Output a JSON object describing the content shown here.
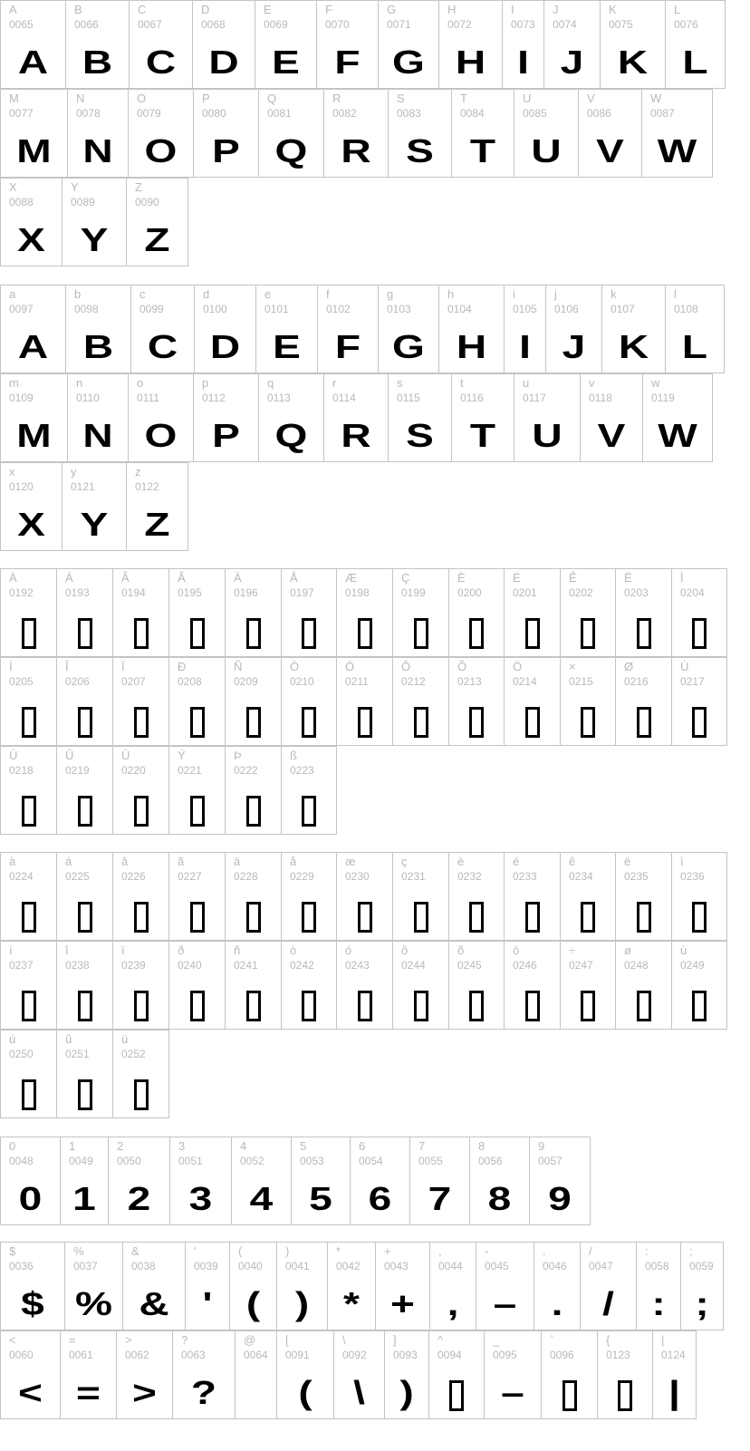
{
  "sections": [
    {
      "rows": [
        [
          {
            "label": "A",
            "code": "0065",
            "glyph": "A"
          },
          {
            "label": "B",
            "code": "0066",
            "glyph": "B"
          },
          {
            "label": "C",
            "code": "0067",
            "glyph": "C"
          },
          {
            "label": "D",
            "code": "0068",
            "glyph": "D"
          },
          {
            "label": "E",
            "code": "0069",
            "glyph": "E"
          },
          {
            "label": "F",
            "code": "0070",
            "glyph": "F"
          },
          {
            "label": "G",
            "code": "0071",
            "glyph": "G"
          },
          {
            "label": "H",
            "code": "0072",
            "glyph": "H"
          },
          {
            "label": "I",
            "code": "0073",
            "glyph": "I"
          },
          {
            "label": "J",
            "code": "0074",
            "glyph": "J"
          },
          {
            "label": "K",
            "code": "0075",
            "glyph": "K"
          },
          {
            "label": "L",
            "code": "0076",
            "glyph": "L"
          }
        ],
        [
          {
            "label": "M",
            "code": "0077",
            "glyph": "M"
          },
          {
            "label": "N",
            "code": "0078",
            "glyph": "N"
          },
          {
            "label": "O",
            "code": "0079",
            "glyph": "O"
          },
          {
            "label": "P",
            "code": "0080",
            "glyph": "P"
          },
          {
            "label": "Q",
            "code": "0081",
            "glyph": "Q"
          },
          {
            "label": "R",
            "code": "0082",
            "glyph": "R"
          },
          {
            "label": "S",
            "code": "0083",
            "glyph": "S"
          },
          {
            "label": "T",
            "code": "0084",
            "glyph": "T"
          },
          {
            "label": "U",
            "code": "0085",
            "glyph": "U"
          },
          {
            "label": "V",
            "code": "0086",
            "glyph": "V"
          },
          {
            "label": "W",
            "code": "0087",
            "glyph": "W"
          }
        ],
        [
          {
            "label": "X",
            "code": "0088",
            "glyph": "X"
          },
          {
            "label": "Y",
            "code": "0089",
            "glyph": "Y"
          },
          {
            "label": "Z",
            "code": "0090",
            "glyph": "Z"
          }
        ]
      ]
    },
    {
      "rows": [
        [
          {
            "label": "a",
            "code": "0097",
            "glyph": "A"
          },
          {
            "label": "b",
            "code": "0098",
            "glyph": "B"
          },
          {
            "label": "c",
            "code": "0099",
            "glyph": "C"
          },
          {
            "label": "d",
            "code": "0100",
            "glyph": "D"
          },
          {
            "label": "e",
            "code": "0101",
            "glyph": "E"
          },
          {
            "label": "f",
            "code": "0102",
            "glyph": "F"
          },
          {
            "label": "g",
            "code": "0103",
            "glyph": "G"
          },
          {
            "label": "h",
            "code": "0104",
            "glyph": "H"
          },
          {
            "label": "i",
            "code": "0105",
            "glyph": "I"
          },
          {
            "label": "j",
            "code": "0106",
            "glyph": "J"
          },
          {
            "label": "k",
            "code": "0107",
            "glyph": "K"
          },
          {
            "label": "l",
            "code": "0108",
            "glyph": "L"
          }
        ],
        [
          {
            "label": "m",
            "code": "0109",
            "glyph": "M"
          },
          {
            "label": "n",
            "code": "0110",
            "glyph": "N"
          },
          {
            "label": "o",
            "code": "0111",
            "glyph": "O"
          },
          {
            "label": "p",
            "code": "0112",
            "glyph": "P"
          },
          {
            "label": "q",
            "code": "0113",
            "glyph": "Q"
          },
          {
            "label": "r",
            "code": "0114",
            "glyph": "R"
          },
          {
            "label": "s",
            "code": "0115",
            "glyph": "S"
          },
          {
            "label": "t",
            "code": "0116",
            "glyph": "T"
          },
          {
            "label": "u",
            "code": "0117",
            "glyph": "U"
          },
          {
            "label": "v",
            "code": "0118",
            "glyph": "V"
          },
          {
            "label": "w",
            "code": "0119",
            "glyph": "W"
          }
        ],
        [
          {
            "label": "x",
            "code": "0120",
            "glyph": "X"
          },
          {
            "label": "y",
            "code": "0121",
            "glyph": "Y"
          },
          {
            "label": "z",
            "code": "0122",
            "glyph": "Z"
          }
        ]
      ]
    },
    {
      "rows": [
        [
          {
            "label": "À",
            "code": "0192",
            "glyph": "",
            "missing": true
          },
          {
            "label": "Á",
            "code": "0193",
            "glyph": "",
            "missing": true
          },
          {
            "label": "Â",
            "code": "0194",
            "glyph": "",
            "missing": true
          },
          {
            "label": "Ã",
            "code": "0195",
            "glyph": "",
            "missing": true
          },
          {
            "label": "Ä",
            "code": "0196",
            "glyph": "",
            "missing": true
          },
          {
            "label": "Å",
            "code": "0197",
            "glyph": "",
            "missing": true
          },
          {
            "label": "Æ",
            "code": "0198",
            "glyph": "",
            "missing": true
          },
          {
            "label": "Ç",
            "code": "0199",
            "glyph": "",
            "missing": true
          },
          {
            "label": "È",
            "code": "0200",
            "glyph": "",
            "missing": true
          },
          {
            "label": "É",
            "code": "0201",
            "glyph": "",
            "missing": true
          },
          {
            "label": "Ê",
            "code": "0202",
            "glyph": "",
            "missing": true
          },
          {
            "label": "Ë",
            "code": "0203",
            "glyph": "",
            "missing": true
          },
          {
            "label": "Ì",
            "code": "0204",
            "glyph": "",
            "missing": true
          }
        ],
        [
          {
            "label": "Í",
            "code": "0205",
            "glyph": "",
            "missing": true
          },
          {
            "label": "Î",
            "code": "0206",
            "glyph": "",
            "missing": true
          },
          {
            "label": "Ï",
            "code": "0207",
            "glyph": "",
            "missing": true
          },
          {
            "label": "Ð",
            "code": "0208",
            "glyph": "",
            "missing": true
          },
          {
            "label": "Ñ",
            "code": "0209",
            "glyph": "",
            "missing": true
          },
          {
            "label": "Ò",
            "code": "0210",
            "glyph": "",
            "missing": true
          },
          {
            "label": "Ó",
            "code": "0211",
            "glyph": "",
            "missing": true
          },
          {
            "label": "Ô",
            "code": "0212",
            "glyph": "",
            "missing": true
          },
          {
            "label": "Õ",
            "code": "0213",
            "glyph": "",
            "missing": true
          },
          {
            "label": "Ö",
            "code": "0214",
            "glyph": "",
            "missing": true
          },
          {
            "label": "×",
            "code": "0215",
            "glyph": "",
            "missing": true
          },
          {
            "label": "Ø",
            "code": "0216",
            "glyph": "",
            "missing": true
          },
          {
            "label": "Ù",
            "code": "0217",
            "glyph": "",
            "missing": true
          }
        ],
        [
          {
            "label": "Ú",
            "code": "0218",
            "glyph": "",
            "missing": true
          },
          {
            "label": "Û",
            "code": "0219",
            "glyph": "",
            "missing": true
          },
          {
            "label": "Ü",
            "code": "0220",
            "glyph": "",
            "missing": true
          },
          {
            "label": "Ý",
            "code": "0221",
            "glyph": "",
            "missing": true
          },
          {
            "label": "Þ",
            "code": "0222",
            "glyph": "",
            "missing": true
          },
          {
            "label": "ß",
            "code": "0223",
            "glyph": "",
            "missing": true
          }
        ]
      ]
    },
    {
      "rows": [
        [
          {
            "label": "à",
            "code": "0224",
            "glyph": "",
            "missing": true
          },
          {
            "label": "á",
            "code": "0225",
            "glyph": "",
            "missing": true
          },
          {
            "label": "â",
            "code": "0226",
            "glyph": "",
            "missing": true
          },
          {
            "label": "ã",
            "code": "0227",
            "glyph": "",
            "missing": true
          },
          {
            "label": "ä",
            "code": "0228",
            "glyph": "",
            "missing": true
          },
          {
            "label": "å",
            "code": "0229",
            "glyph": "",
            "missing": true
          },
          {
            "label": "æ",
            "code": "0230",
            "glyph": "",
            "missing": true
          },
          {
            "label": "ç",
            "code": "0231",
            "glyph": "",
            "missing": true
          },
          {
            "label": "è",
            "code": "0232",
            "glyph": "",
            "missing": true
          },
          {
            "label": "é",
            "code": "0233",
            "glyph": "",
            "missing": true
          },
          {
            "label": "ê",
            "code": "0234",
            "glyph": "",
            "missing": true
          },
          {
            "label": "ë",
            "code": "0235",
            "glyph": "",
            "missing": true
          },
          {
            "label": "ì",
            "code": "0236",
            "glyph": "",
            "missing": true
          }
        ],
        [
          {
            "label": "í",
            "code": "0237",
            "glyph": "",
            "missing": true
          },
          {
            "label": "î",
            "code": "0238",
            "glyph": "",
            "missing": true
          },
          {
            "label": "ï",
            "code": "0239",
            "glyph": "",
            "missing": true
          },
          {
            "label": "ð",
            "code": "0240",
            "glyph": "",
            "missing": true
          },
          {
            "label": "ñ",
            "code": "0241",
            "glyph": "",
            "missing": true
          },
          {
            "label": "ò",
            "code": "0242",
            "glyph": "",
            "missing": true
          },
          {
            "label": "ó",
            "code": "0243",
            "glyph": "",
            "missing": true
          },
          {
            "label": "ô",
            "code": "0244",
            "glyph": "",
            "missing": true
          },
          {
            "label": "õ",
            "code": "0245",
            "glyph": "",
            "missing": true
          },
          {
            "label": "ö",
            "code": "0246",
            "glyph": "",
            "missing": true
          },
          {
            "label": "÷",
            "code": "0247",
            "glyph": "",
            "missing": true
          },
          {
            "label": "ø",
            "code": "0248",
            "glyph": "",
            "missing": true
          },
          {
            "label": "ù",
            "code": "0249",
            "glyph": "",
            "missing": true
          }
        ],
        [
          {
            "label": "ú",
            "code": "0250",
            "glyph": "",
            "missing": true
          },
          {
            "label": "û",
            "code": "0251",
            "glyph": "",
            "missing": true
          },
          {
            "label": "ü",
            "code": "0252",
            "glyph": "",
            "missing": true
          }
        ]
      ]
    },
    {
      "rows": [
        [
          {
            "label": "0",
            "code": "0048",
            "glyph": "0"
          },
          {
            "label": "1",
            "code": "0049",
            "glyph": "1"
          },
          {
            "label": "2",
            "code": "0050",
            "glyph": "2"
          },
          {
            "label": "3",
            "code": "0051",
            "glyph": "3"
          },
          {
            "label": "4",
            "code": "0052",
            "glyph": "4"
          },
          {
            "label": "5",
            "code": "0053",
            "glyph": "5"
          },
          {
            "label": "6",
            "code": "0054",
            "glyph": "6"
          },
          {
            "label": "7",
            "code": "0055",
            "glyph": "7"
          },
          {
            "label": "8",
            "code": "0056",
            "glyph": "8"
          },
          {
            "label": "9",
            "code": "0057",
            "glyph": "9"
          }
        ]
      ]
    },
    {
      "rows": [
        [
          {
            "label": "$",
            "code": "0036",
            "glyph": "$"
          },
          {
            "label": "%",
            "code": "0037",
            "glyph": "%"
          },
          {
            "label": "&",
            "code": "0038",
            "glyph": "&"
          },
          {
            "label": "'",
            "code": "0039",
            "glyph": "'"
          },
          {
            "label": "(",
            "code": "0040",
            "glyph": "("
          },
          {
            "label": ")",
            "code": "0041",
            "glyph": ")"
          },
          {
            "label": "*",
            "code": "0042",
            "glyph": "*"
          },
          {
            "label": "+",
            "code": "0043",
            "glyph": "+"
          },
          {
            "label": ",",
            "code": "0044",
            "glyph": ","
          },
          {
            "label": "-",
            "code": "0045",
            "glyph": "–"
          },
          {
            "label": ".",
            "code": "0046",
            "glyph": "."
          },
          {
            "label": "/",
            "code": "0047",
            "glyph": "/"
          },
          {
            "label": ":",
            "code": "0058",
            "glyph": ":"
          },
          {
            "label": ";",
            "code": "0059",
            "glyph": ";"
          }
        ],
        [
          {
            "label": "<",
            "code": "0060",
            "glyph": "<"
          },
          {
            "label": "=",
            "code": "0061",
            "glyph": "="
          },
          {
            "label": ">",
            "code": "0062",
            "glyph": ">"
          },
          {
            "label": "?",
            "code": "0063",
            "glyph": "?"
          },
          {
            "label": "@",
            "code": "0064",
            "glyph": ""
          },
          {
            "label": "[",
            "code": "0091",
            "glyph": "("
          },
          {
            "label": "\\",
            "code": "0092",
            "glyph": "\\"
          },
          {
            "label": "]",
            "code": "0093",
            "glyph": ")"
          },
          {
            "label": "^",
            "code": "0094",
            "glyph": "",
            "missing": true
          },
          {
            "label": "_",
            "code": "0095",
            "glyph": "–"
          },
          {
            "label": "`",
            "code": "0096",
            "glyph": "",
            "missing": true
          },
          {
            "label": "{",
            "code": "0123",
            "glyph": "",
            "missing": true
          },
          {
            "label": "|",
            "code": "0124",
            "glyph": "|"
          }
        ]
      ]
    }
  ]
}
